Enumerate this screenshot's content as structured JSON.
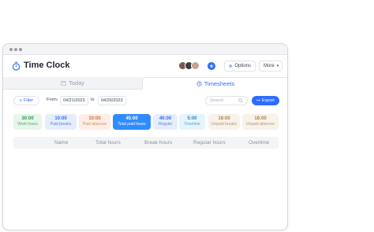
{
  "app": {
    "title": "Time Clock"
  },
  "header": {
    "options_label": "Options",
    "more_label": "More",
    "add_label": "+"
  },
  "tabs": [
    {
      "label": "Today"
    },
    {
      "label": "Timesheets"
    }
  ],
  "filters": {
    "filter_label": "Filter",
    "from_label": "From:",
    "from_date": "04/21/2023",
    "to_label": "to",
    "to_date": "04/26/2023",
    "search_placeholder": "Search",
    "export_label": "Export"
  },
  "stats": [
    {
      "value": "30:00",
      "label": "Work hours",
      "bg": "#e6f6ea",
      "color": "#2e9a4b",
      "label_color": "#5aa66e"
    },
    {
      "value": "10:00",
      "label": "Paid breaks",
      "bg": "#e6eefc",
      "color": "#2f6bff",
      "label_color": "#5a82d6"
    },
    {
      "value": "10:00",
      "label": "Paid absence",
      "bg": "#fdeee6",
      "color": "#e2692d",
      "label_color": "#d88860"
    },
    {
      "value": "45:00",
      "label": "Total paid hours",
      "bg": "#2f8cff",
      "color": "#ffffff",
      "label_color": "#ffffff"
    },
    {
      "value": "40:00",
      "label": "Regular",
      "bg": "#e6eefc",
      "color": "#2f6bff",
      "label_color": "#5a82d6"
    },
    {
      "value": "5:00",
      "label": "Overtime",
      "bg": "#e6f4fc",
      "color": "#2f86c9",
      "label_color": "#5aa0d0"
    },
    {
      "value": "18:00",
      "label": "Unpaid breaks",
      "bg": "#f7f2ea",
      "color": "#b38447",
      "label_color": "#b8996d"
    },
    {
      "value": "18:00",
      "label": "Unpaid absence",
      "bg": "#f7f2ea",
      "color": "#b38447",
      "label_color": "#b8996d"
    }
  ],
  "table": {
    "columns": [
      "Name",
      "Total hours",
      "Break hours",
      "Regular hours",
      "Overtime"
    ]
  }
}
